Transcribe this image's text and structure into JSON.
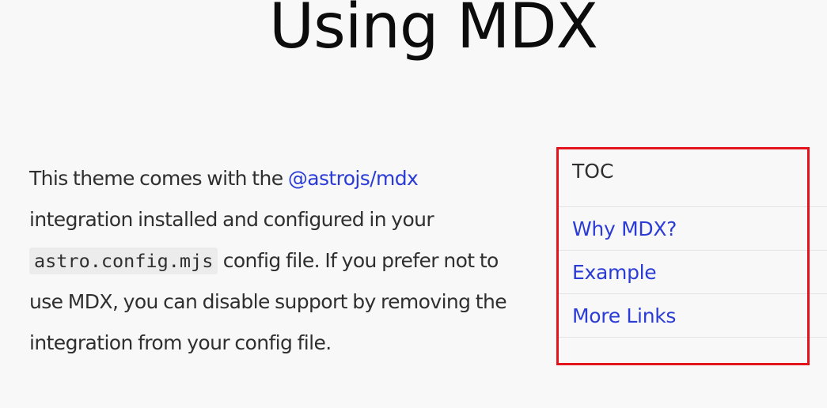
{
  "page": {
    "title": "Using MDX"
  },
  "intro": {
    "text_1": "This theme comes with the ",
    "link_label": "@astrojs/mdx",
    "text_2": " integration installed and configured in your ",
    "code": "astro.config.mjs",
    "text_3": " config file. If you prefer not to use MDX, you can disable support by removing the integration from your config file."
  },
  "toc": {
    "title": "TOC",
    "items": [
      {
        "label": "Why MDX?"
      },
      {
        "label": "Example"
      },
      {
        "label": "More Links"
      }
    ]
  },
  "colors": {
    "background": "#f8f8f8",
    "link": "#2b3bd6",
    "highlight_outline": "#e4141c",
    "text": "#2f2f2f"
  }
}
